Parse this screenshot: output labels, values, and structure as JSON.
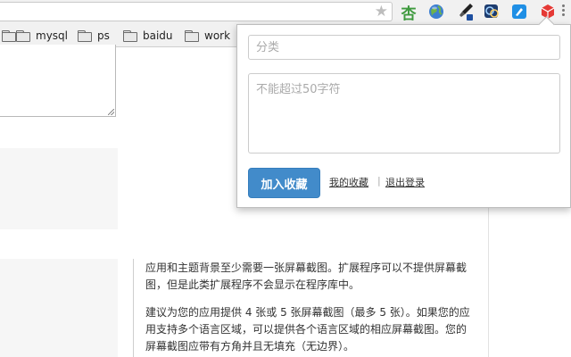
{
  "toolbar": {
    "extensions": [
      {
        "name": "xing-extension",
        "label": "杏"
      },
      {
        "name": "globe-extension"
      },
      {
        "name": "color-picker-extension"
      },
      {
        "name": "photoshop-extension"
      },
      {
        "name": "blue-extension"
      },
      {
        "name": "favorites-cube-extension"
      }
    ]
  },
  "bookmarks": [
    {
      "label": "mysql"
    },
    {
      "label": "ps"
    },
    {
      "label": "baidu"
    },
    {
      "label": "work"
    }
  ],
  "popup": {
    "category_placeholder": "分类",
    "note_placeholder": "不能超过50字符",
    "submit_label": "加入收藏",
    "my_favorites_label": "我的收藏",
    "separator": "|",
    "logout_label": "退出登录"
  },
  "page": {
    "hint_1": "应用和主题背景至少需要一张屏幕截图。扩展程序可以不提供屏幕截图，但是此类扩展程序不会显示在程序库中。",
    "hint_2": "建议为您的应用提供 4 张或 5 张屏幕截图（最多 5 张）。如果您的应用支持多个语言区域，可以提供各个语言区域的相应屏幕截图。您的屏幕截图应带有方角并且无填充（无边界）。"
  },
  "colors": {
    "primary_button": "#428bca",
    "xing_icon": "#3f9a3f",
    "cube_icon": "#e53935"
  }
}
